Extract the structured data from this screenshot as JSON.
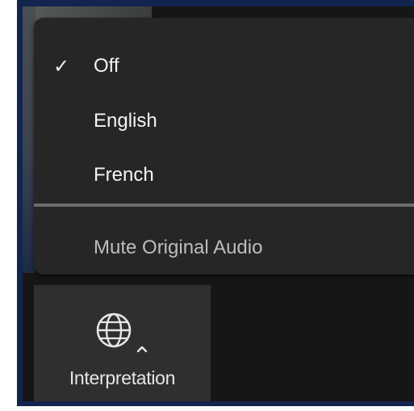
{
  "menu": {
    "selected_check": "✓",
    "items": [
      {
        "label": "Off",
        "selected": true
      },
      {
        "label": "English",
        "selected": false
      },
      {
        "label": "French",
        "selected": false
      }
    ],
    "mute_label": "Mute Original Audio"
  },
  "toolbar": {
    "interpretation_label": "Interpretation",
    "icon": "globe-icon"
  },
  "colors": {
    "frame": "#12254f",
    "menu_bg": "#262626",
    "text": "#f4f4f4",
    "toolbar_bg": "#2f2f2f"
  }
}
